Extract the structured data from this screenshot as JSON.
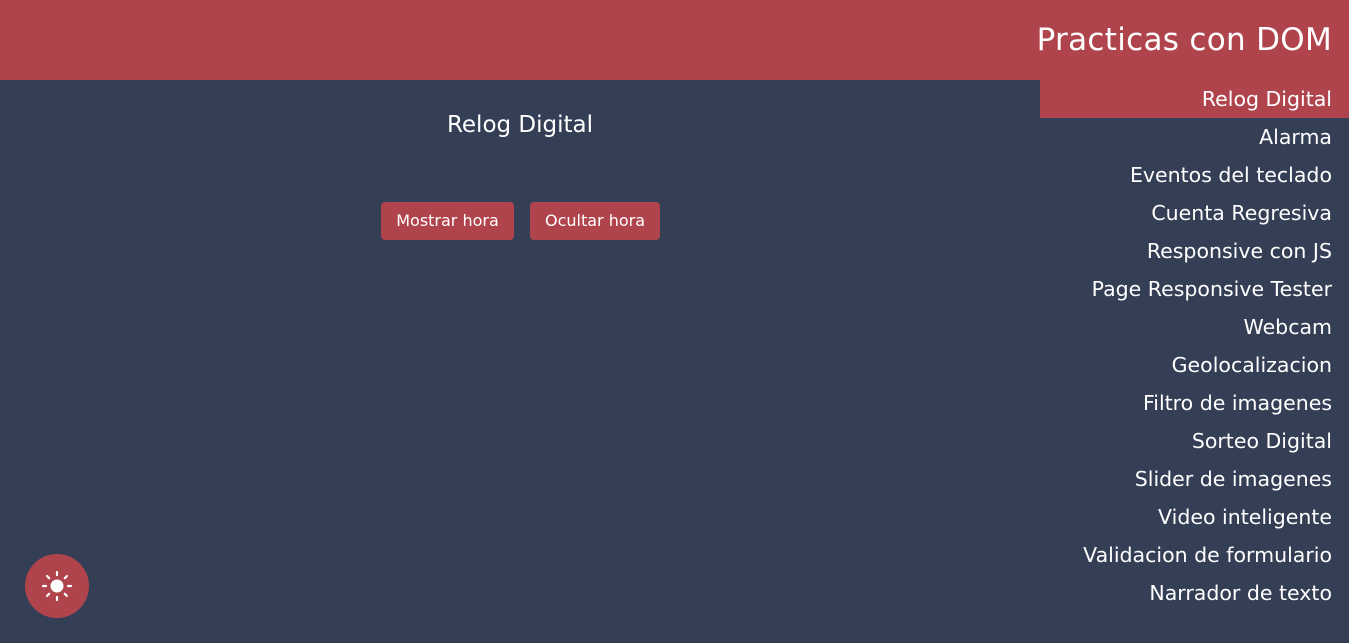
{
  "header": {
    "title": "Practicas con DOM"
  },
  "main": {
    "section_title": "Relog Digital",
    "buttons": {
      "show_label": "Mostrar hora",
      "hide_label": "Ocultar hora"
    }
  },
  "nav": {
    "active_index": 0,
    "items": [
      {
        "label": "Relog Digital"
      },
      {
        "label": "Alarma"
      },
      {
        "label": "Eventos del teclado"
      },
      {
        "label": "Cuenta Regresiva"
      },
      {
        "label": "Responsive con JS"
      },
      {
        "label": "Page Responsive Tester"
      },
      {
        "label": "Webcam"
      },
      {
        "label": "Geolocalizacion"
      },
      {
        "label": "Filtro de imagenes"
      },
      {
        "label": "Sorteo Digital"
      },
      {
        "label": "Slider de imagenes"
      },
      {
        "label": "Video inteligente"
      },
      {
        "label": "Validacion de formulario"
      },
      {
        "label": "Narrador de texto"
      }
    ]
  },
  "theme_toggle": {
    "icon": "sun-icon"
  },
  "colors": {
    "background": "#343e55",
    "accent": "#b0444d",
    "text": "#ffffff"
  }
}
